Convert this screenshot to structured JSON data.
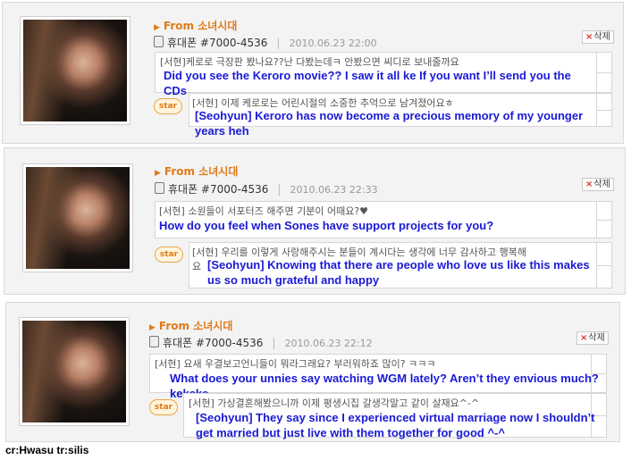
{
  "posts": [
    {
      "from": "From 소녀시대",
      "phone": "휴대폰 #7000-4536",
      "date": "2010.06.23 22:00",
      "delete": "삭제",
      "question_kr": "[서현]케로로 극장판 봤나요??난 다봤는데ㅋ 안봤으면 씨디로 보내줄까요",
      "question_en": "Did you see the Keroro movie?? I saw it all ke If you want I’ll send you the CDs",
      "star": "star",
      "answer_kr": "[서현] 이제 케로로는 어린시절의 소중한 추억으로 남겨졌어요ㅎ",
      "answer_en": "[Seohyun] Keroro has now become a precious memory of my younger years heh"
    },
    {
      "from": "From 소녀시대",
      "phone": "휴대폰 #7000-4536",
      "date": "2010.06.23 22:33",
      "delete": "삭제",
      "question_kr": "[서현] 소원들이 서포터즈 해주면 기분이 어때요?♥",
      "question_en": "How do you feel when Sones have support projects for you?",
      "star": "star",
      "answer_kr": "[서현] 우리를 이렇게 사랑해주시는 분들이 계시다는 생각에 너무 감사하고 행복해",
      "answer_kr2": "요",
      "answer_en": "[Seohyun] Knowing that there are people who love us like this makes us so much grateful and happy"
    },
    {
      "from": "From 소녀시대",
      "phone": "휴대폰 #7000-4536",
      "date": "2010.06.23 22:12",
      "delete": "삭제",
      "question_kr": "[서현] 요새 우결보고언니들이 뭐라그래요? 부러워하죠 많이? ㅋㅋㅋ",
      "question_en": "What does your unnies say watching WGM lately? Aren’t they envious much? kekeke",
      "star": "star",
      "answer_kr": "[서현] 가상결혼해봤으니까 이제 평생시집 갈생각말고 같이 살재요^-^",
      "answer_en": "[Seohyun] They say since I experienced virtual marriage now I shouldn’t get married but just live with them together for good ^-^"
    }
  ],
  "credit": "cr:Hwasu tr:silis",
  "colors": {
    "from": "#e07a1a",
    "translation": "#1a1ad6",
    "card_bg": "#f3f3f3",
    "delete_x": "#dd3333"
  }
}
